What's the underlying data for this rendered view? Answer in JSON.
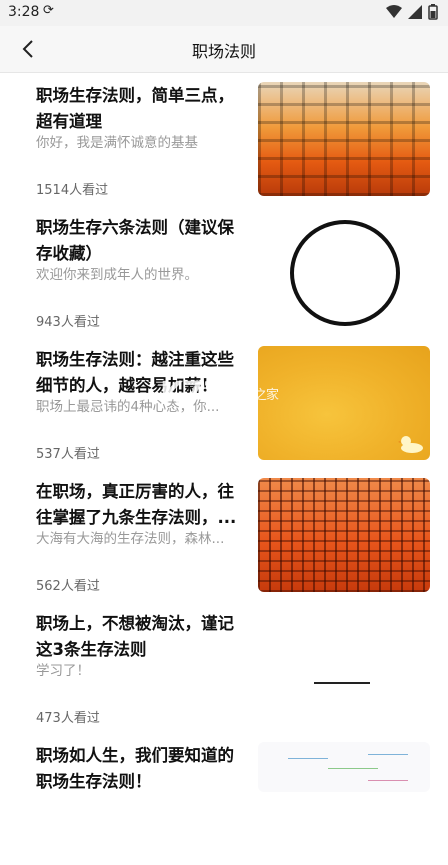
{
  "status_bar": {
    "time": "3:28",
    "sync_icon": "sync-icon"
  },
  "header": {
    "title": "职场法则"
  },
  "articles": [
    {
      "title": "职场生存法则，简单三点，超有道理",
      "subtitle": "你好，我是满怀诚意的基基",
      "views": "1514人看过"
    },
    {
      "title": "职场生存六条法则（建议保存收藏）",
      "subtitle": "欢迎你来到成年人的世界。",
      "views": "943人看过"
    },
    {
      "title": "职场生存法则：越注重这些细节的人，越容易加薪！",
      "subtitle": "职场上最忌讳的4种心态，你...",
      "views": "537人看过"
    },
    {
      "title": "在职场，真正厉害的人，往往掌握了九条生存法则，...",
      "subtitle": "大海有大海的生存法则，森林...",
      "views": "562人看过"
    },
    {
      "title": "职场上，不想被淘汰，谨记这3条生存法则",
      "subtitle": "学习了！",
      "views": "473人看过"
    },
    {
      "title": "职场如人生，我们要知道的职场生存法则！",
      "subtitle": "",
      "views": ""
    }
  ],
  "watermark": {
    "main": "K73",
    "sub": "游戏之家"
  }
}
